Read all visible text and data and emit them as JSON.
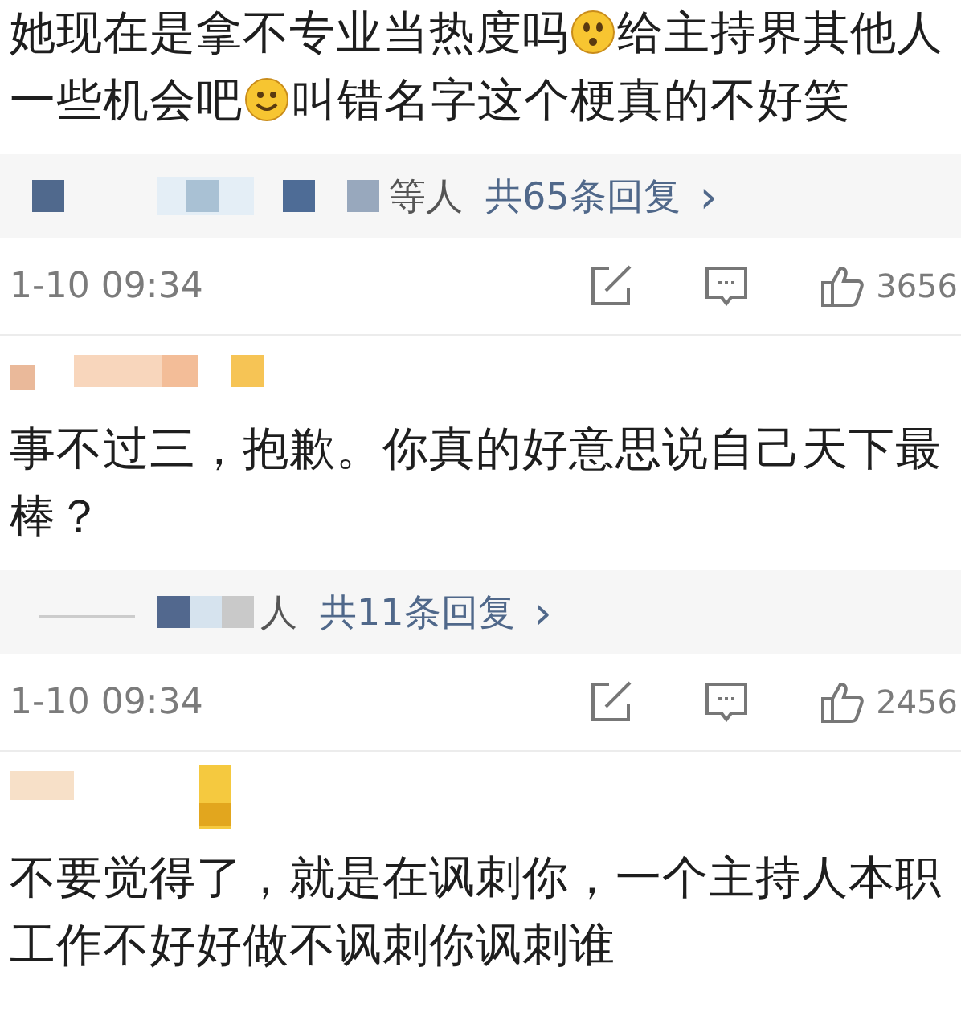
{
  "comments": [
    {
      "body": [
        {
          "kind": "text",
          "text": "她现在是拿不专业当热度吗"
        },
        {
          "kind": "puzzled_emoji"
        },
        {
          "kind": "text",
          "text": "给主持界其他人一些机会吧"
        },
        {
          "kind": "smile_emoji"
        },
        {
          "kind": "text",
          "text": "叫错名字这个梗真的不好笑"
        }
      ],
      "replies": {
        "suffix": "等人",
        "count": "共65条回复",
        "arrow": "›"
      },
      "time": "1-10 09:34",
      "likes": "3656"
    },
    {
      "body": [
        {
          "kind": "text",
          "text": "事不过三，抱歉。你真的好意思说自己天下最棒？"
        }
      ],
      "replies": {
        "suffix": "人",
        "count": "共11条回复",
        "arrow": "›"
      },
      "time": "1-10 09:34",
      "likes": "2456"
    },
    {
      "body": [
        {
          "kind": "text",
          "text": "不要觉得了，就是在讽刺你，一个主持人本职工作不好好做不讽刺你讽刺谁"
        }
      ]
    }
  ]
}
